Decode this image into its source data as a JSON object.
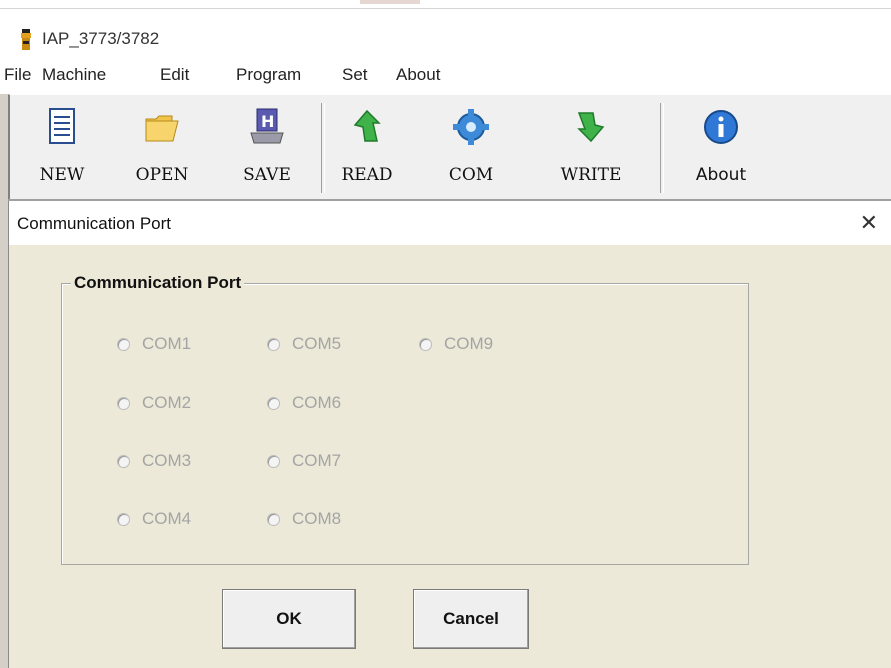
{
  "app": {
    "title": "IAP_3773/3782",
    "icon": "flashlight-icon"
  },
  "menu": [
    "File",
    "Machine",
    "Edit",
    "Program",
    "Set",
    "About"
  ],
  "toolbar": {
    "buttons": [
      {
        "label": "NEW",
        "icon": "new-document-icon"
      },
      {
        "label": "OPEN",
        "icon": "open-folder-icon"
      },
      {
        "label": "SAVE",
        "icon": "save-disk-icon"
      },
      {
        "label": "READ",
        "icon": "read-arrow-icon"
      },
      {
        "label": "COM",
        "icon": "com-gear-icon"
      },
      {
        "label": "WRITE",
        "icon": "write-arrow-icon"
      },
      {
        "label": "About",
        "icon": "info-icon"
      }
    ]
  },
  "dialog": {
    "title": "Communication Port",
    "close": "✕",
    "group_label": "Communication Port",
    "ports": [
      "COM1",
      "COM2",
      "COM3",
      "COM4",
      "COM5",
      "COM6",
      "COM7",
      "COM8",
      "COM9"
    ],
    "ok_label": "OK",
    "cancel_label": "Cancel"
  }
}
